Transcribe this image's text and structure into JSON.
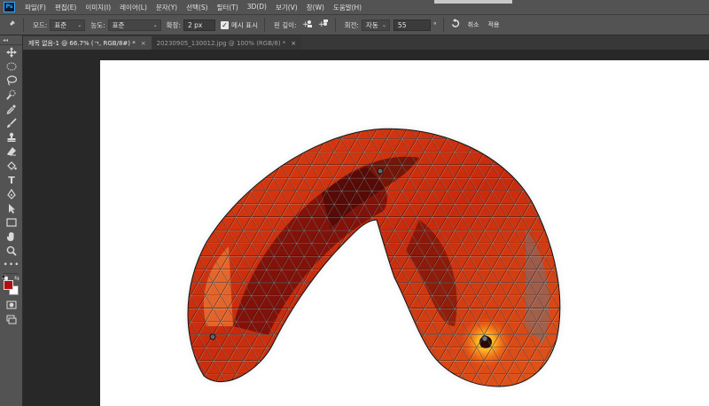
{
  "app": {
    "logo": "Ps"
  },
  "menu": [
    "파일(F)",
    "편집(E)",
    "이미지(I)",
    "레이어(L)",
    "문자(Y)",
    "선택(S)",
    "필터(T)",
    "3D(D)",
    "보기(V)",
    "창(W)",
    "도움말(H)"
  ],
  "options": {
    "pin_icon": "pushpin-icon",
    "mode_label": "모드:",
    "mode_value": "표준",
    "density_label": "농도:",
    "density_value": "표준",
    "expand_label": "확장:",
    "expand_value": "2 px",
    "show_mesh_label": "메시 표시",
    "show_mesh_checked": true,
    "pin_depth_label": "핀 깊이:",
    "rotate_label": "회전:",
    "rotate_mode": "자동",
    "rotate_value": "55",
    "degree_symbol": "°",
    "cancel_label": "취소",
    "apply_label": "적용"
  },
  "tabs": [
    {
      "title": "제목 없음-1 @ 66.7% (ㄱ, RGB/8#) *",
      "active": true
    },
    {
      "title": "20230905_130012.jpg @ 100% (RGB/8) *",
      "active": false
    }
  ],
  "tabs_close_glyph": "×",
  "tools_collapse": "◂◂",
  "colors": {
    "foreground": "#b40f0f",
    "background": "#ffffff",
    "accent": "#31a8ff"
  },
  "canvas": {
    "subject": "puppet-warp-mesh"
  }
}
